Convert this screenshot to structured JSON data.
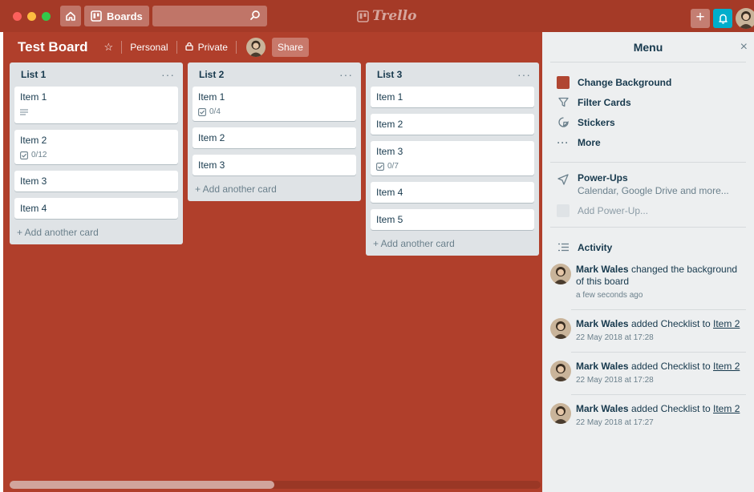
{
  "topbar": {
    "boards_label": "Boards",
    "logo_text": "Trello",
    "plus_label": "+"
  },
  "board": {
    "title": "Test Board",
    "team": "Personal",
    "visibility": "Private",
    "share_label": "Share"
  },
  "lists": [
    {
      "title": "List 1",
      "cards": [
        {
          "title": "Item 1",
          "badge": ""
        },
        {
          "title": "Item 2",
          "badge": "0/12"
        },
        {
          "title": "Item 3",
          "badge": ""
        },
        {
          "title": "Item 4",
          "badge": ""
        }
      ],
      "add_label": "+ Add another card"
    },
    {
      "title": "List 2",
      "cards": [
        {
          "title": "Item 1",
          "badge": "0/4"
        },
        {
          "title": "Item 2",
          "badge": ""
        },
        {
          "title": "Item 3",
          "badge": ""
        }
      ],
      "add_label": "+ Add another card"
    },
    {
      "title": "List 3",
      "cards": [
        {
          "title": "Item 1",
          "badge": ""
        },
        {
          "title": "Item 2",
          "badge": ""
        },
        {
          "title": "Item 3",
          "badge": "0/7"
        },
        {
          "title": "Item 4",
          "badge": ""
        },
        {
          "title": "Item 5",
          "badge": ""
        }
      ],
      "add_label": "+ Add another card"
    }
  ],
  "menu": {
    "title": "Menu",
    "close_label": "×",
    "items": [
      {
        "label": "Change Background",
        "icon": "color-swatch-icon"
      },
      {
        "label": "Filter Cards",
        "icon": "filter-icon"
      },
      {
        "label": "Stickers",
        "icon": "sticker-icon"
      },
      {
        "label": "More",
        "icon": "more-icon"
      }
    ],
    "powerups": {
      "title": "Power-Ups",
      "subtitle": "Calendar, Google Drive and more...",
      "add_label": "Add Power-Up..."
    },
    "activity_title": "Activity",
    "activity": [
      {
        "user": "Mark Wales",
        "text": "changed the background of this board",
        "link": "",
        "time": "a few seconds ago"
      },
      {
        "user": "Mark Wales",
        "text": "added Checklist to",
        "link": "Item 2",
        "time": "22 May 2018 at 17:28"
      },
      {
        "user": "Mark Wales",
        "text": "added Checklist to",
        "link": "Item 2",
        "time": "22 May 2018 at 17:28"
      },
      {
        "user": "Mark Wales",
        "text": "added Checklist to",
        "link": "Item 2",
        "time": "22 May 2018 at 17:27"
      }
    ]
  },
  "colors": {
    "topbar": "#a53a27",
    "board_bg": "#b03f2b",
    "notification": "#00aecc",
    "swatch": "#b04632"
  }
}
